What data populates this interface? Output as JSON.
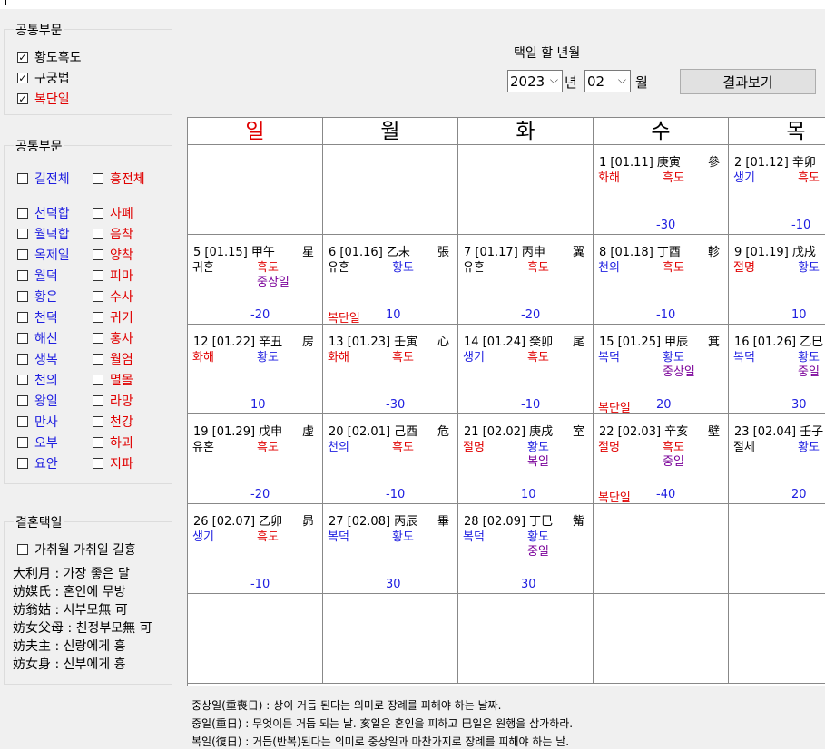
{
  "group1": {
    "title": "공통부문",
    "items": [
      {
        "label": "황도흑도",
        "checked": true,
        "color": "black"
      },
      {
        "label": "구궁법",
        "checked": true,
        "color": "black"
      },
      {
        "label": "복단일",
        "checked": true,
        "color": "red"
      }
    ]
  },
  "group2": {
    "title": "공통부문",
    "left": [
      "길전체",
      "천덕합",
      "월덕합",
      "옥제일",
      "월덕",
      "황은",
      "천덕",
      "해신",
      "생복",
      "천의",
      "왕일",
      "만사",
      "오부",
      "요안"
    ],
    "right": [
      "흉전체",
      "사폐",
      "음착",
      "양착",
      "피마",
      "수사",
      "귀기",
      "홍사",
      "월염",
      "멸몰",
      "라망",
      "천강",
      "하괴",
      "지파"
    ]
  },
  "group3": {
    "title": "결혼택일",
    "checkbox": "가취월 가취일 길흉",
    "notes": [
      "大利月 : 가장 좋은 달",
      "妨媒氏 : 혼인에 무방",
      "妨翁姑 : 시부모無 可",
      "妨女父母 : 친정부모無 可",
      "妨夫主 : 신랑에게 흉",
      "妨女身 : 신부에게 흉"
    ]
  },
  "picker": {
    "label": "택일 할 년월",
    "year": "2023",
    "year_unit": "년",
    "month": "02",
    "month_unit": "월",
    "button": "결과보기"
  },
  "calendar": {
    "weekdays": [
      "일",
      "월",
      "화",
      "수",
      "목"
    ],
    "weeks": [
      [
        null,
        null,
        null,
        {
          "hdr": "1 [01.11] 庚寅",
          "star": "參",
          "l": "화해",
          "lc": "red",
          "r": [
            "흑도"
          ],
          "rc": "red",
          "num": "-30"
        },
        {
          "hdr": "2 [01.12] 辛卯",
          "star": "",
          "l": "생기",
          "lc": "blue",
          "r": [
            "흑도"
          ],
          "rc": "red",
          "num": "-10"
        }
      ],
      [
        {
          "hdr": "5 [01.15] 甲午",
          "star": "星",
          "l": "귀혼",
          "lc": "black",
          "r": [
            "흑도",
            "중상일"
          ],
          "rc": "red",
          "num": "-20"
        },
        {
          "hdr": "6 [01.16] 乙未",
          "star": "張",
          "l": "유혼",
          "lc": "black",
          "r": [
            "황도"
          ],
          "rc": "blue",
          "num": "10",
          "bokdan": "복단일"
        },
        {
          "hdr": "7 [01.17] 丙申",
          "star": "翼",
          "l": "유혼",
          "lc": "black",
          "r": [
            "흑도"
          ],
          "rc": "red",
          "num": "-20"
        },
        {
          "hdr": "8 [01.18] 丁酉",
          "star": "軫",
          "l": "천의",
          "lc": "blue",
          "r": [
            "흑도"
          ],
          "rc": "red",
          "num": "-10"
        },
        {
          "hdr": "9 [01.19] 戊戌",
          "star": "",
          "l": "절명",
          "lc": "red",
          "r": [
            "황도"
          ],
          "rc": "blue",
          "num": "10"
        }
      ],
      [
        {
          "hdr": "12 [01.22] 辛丑",
          "star": "房",
          "l": "화해",
          "lc": "red",
          "r": [
            "황도"
          ],
          "rc": "blue",
          "num": "10"
        },
        {
          "hdr": "13 [01.23] 壬寅",
          "star": "心",
          "l": "화해",
          "lc": "red",
          "r": [
            "흑도"
          ],
          "rc": "red",
          "num": "-30"
        },
        {
          "hdr": "14 [01.24] 癸卯",
          "star": "尾",
          "l": "생기",
          "lc": "blue",
          "r": [
            "흑도"
          ],
          "rc": "red",
          "num": "-10"
        },
        {
          "hdr": "15 [01.25] 甲辰",
          "star": "箕",
          "l": "복덕",
          "lc": "blue",
          "r": [
            "황도",
            "중상일"
          ],
          "rc": "blue",
          "num": "20",
          "bokdan": "복단일"
        },
        {
          "hdr": "16 [01.26] 乙巳",
          "star": "",
          "l": "복덕",
          "lc": "blue",
          "r": [
            "황도",
            "중일"
          ],
          "rc": "blue",
          "num": "30"
        }
      ],
      [
        {
          "hdr": "19 [01.29] 戊申",
          "star": "虛",
          "l": "유혼",
          "lc": "black",
          "r": [
            "흑도"
          ],
          "rc": "red",
          "num": "-20"
        },
        {
          "hdr": "20 [02.01] 己酉",
          "star": "危",
          "l": "천의",
          "lc": "blue",
          "r": [
            "흑도"
          ],
          "rc": "red",
          "num": "-10"
        },
        {
          "hdr": "21 [02.02] 庚戌",
          "star": "室",
          "l": "절명",
          "lc": "red",
          "r": [
            "황도",
            "복일"
          ],
          "rc": "blue",
          "num": "10"
        },
        {
          "hdr": "22 [02.03] 辛亥",
          "star": "壁",
          "l": "절명",
          "lc": "red",
          "r": [
            "흑도",
            "중일"
          ],
          "rc": "red",
          "num": "-40",
          "bokdan": "복단일"
        },
        {
          "hdr": "23 [02.04] 壬子",
          "star": "",
          "l": "절체",
          "lc": "black",
          "r": [
            "황도"
          ],
          "rc": "blue",
          "num": "20"
        }
      ],
      [
        {
          "hdr": "26 [02.07] 乙卯",
          "star": "昴",
          "l": "생기",
          "lc": "blue",
          "r": [
            "흑도"
          ],
          "rc": "red",
          "num": "-10"
        },
        {
          "hdr": "27 [02.08] 丙辰",
          "star": "畢",
          "l": "복덕",
          "lc": "blue",
          "r": [
            "황도"
          ],
          "rc": "blue",
          "num": "30"
        },
        {
          "hdr": "28 [02.09] 丁巳",
          "star": "觜",
          "l": "복덕",
          "lc": "blue",
          "r": [
            "황도",
            "중일"
          ],
          "rc": "blue",
          "num": "30"
        },
        null,
        null
      ],
      [
        null,
        null,
        null,
        null,
        null
      ]
    ]
  },
  "footnotes": [
    "중상일(重喪日) : 상이 거듭 된다는 의미로 장례를 피해야 하는 날짜.",
    "중일(重日) : 무엇이든 거듭 되는 날. 亥일은 혼인을 피하고 巳일은 원행을 삼가하라.",
    "복일(復日) : 거듭(반복)된다는 의미로 중상일과 마찬가지로 장례를 피해야 하는 날."
  ],
  "colors": {
    "red": "#e00000",
    "blue": "#1e1ee0",
    "purple": "#7a0099"
  }
}
